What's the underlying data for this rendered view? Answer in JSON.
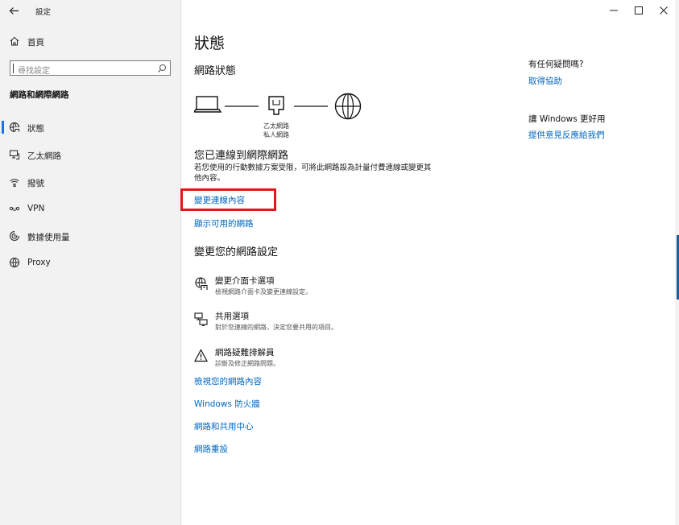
{
  "window": {
    "title": "設定",
    "controls": {
      "minimize": "—",
      "maximize": "☐",
      "close": "✕"
    }
  },
  "sidebar": {
    "home_label": "首頁",
    "search_placeholder": "尋找設定",
    "section_title": "網路和網際網路",
    "items": [
      {
        "label": "狀態",
        "icon": "globe-status-icon",
        "active": true
      },
      {
        "label": "乙太網路",
        "icon": "ethernet-icon",
        "active": false
      },
      {
        "label": "撥號",
        "icon": "dialup-icon",
        "active": false
      },
      {
        "label": "VPN",
        "icon": "vpn-icon",
        "active": false
      },
      {
        "label": "數據使用量",
        "icon": "data-usage-icon",
        "active": false
      },
      {
        "label": "Proxy",
        "icon": "globe-icon",
        "active": false
      }
    ]
  },
  "main": {
    "title": "狀態",
    "network_status_heading": "網路狀態",
    "diagram_caption_line1": "乙太網路",
    "diagram_caption_line2": "私人網路",
    "connected_title": "您已連線到網際網路",
    "connected_desc": "若您使用的行動數據方案受限，可將此網路設為計量付費連線或變更其他內容。",
    "link_change_connection": "變更連線內容",
    "link_show_available": "顯示可用的網路",
    "change_settings_heading": "變更您的網路設定",
    "settings": [
      {
        "title": "變更介面卡選項",
        "desc": "檢視網路介面卡及變更連線設定。",
        "icon": "adapter-icon"
      },
      {
        "title": "共用選項",
        "desc": "對於您連線的網路，決定您要共用的項目。",
        "icon": "sharing-icon"
      },
      {
        "title": "網路疑難排解員",
        "desc": "診斷及修正網路問題。",
        "icon": "warning-icon"
      }
    ],
    "links": [
      "檢視您的網路內容",
      "Windows 防火牆",
      "網路和共用中心",
      "網路重設"
    ]
  },
  "aside": {
    "question_heading": "有任何疑問嗎?",
    "get_help": "取得協助",
    "improve_heading": "讓 Windows 更好用",
    "feedback": "提供意見反應給我們"
  },
  "colors": {
    "link": "#0067c0",
    "highlight": "#e01a1a",
    "sidebar_bg": "#f2f2f2",
    "accent": "#1a73e8"
  }
}
